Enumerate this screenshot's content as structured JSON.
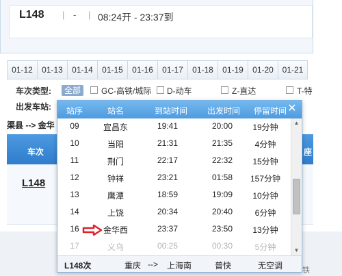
{
  "top": {
    "train_no": "L148",
    "sep": "|",
    "dash": "-",
    "time": "08:24开 - 23:37到"
  },
  "dates": [
    "01-12",
    "01-13",
    "01-14",
    "01-15",
    "01-16",
    "01-17",
    "01-18",
    "01-19",
    "01-20",
    "01-21"
  ],
  "filters": {
    "type_label": "车次类型:",
    "all_label": "全部",
    "gc_label": "GC-高铁/城际",
    "d_label": "D-动车",
    "z_label": "Z-直达",
    "t_label": "T-特",
    "depart_label": "出发车站:"
  },
  "route": "渠县 --> 金华",
  "background_table": {
    "col_train": "车次",
    "col_seat": "座",
    "train": "L148"
  },
  "corner_text": "铁",
  "popup": {
    "headers": {
      "no": "站序",
      "name": "站名",
      "arrive": "到站时间",
      "depart": "出发时间",
      "stay": "停留时间"
    },
    "close_symbol": "✕",
    "rows": [
      {
        "no": "09",
        "name": "宜昌东",
        "arrive": "19:41",
        "depart": "20:00",
        "stay": "19分钟"
      },
      {
        "no": "10",
        "name": "当阳",
        "arrive": "21:31",
        "depart": "21:35",
        "stay": "4分钟"
      },
      {
        "no": "11",
        "name": "荆门",
        "arrive": "22:17",
        "depart": "22:32",
        "stay": "15分钟"
      },
      {
        "no": "12",
        "name": "钟祥",
        "arrive": "23:21",
        "depart": "01:58",
        "stay": "157分钟"
      },
      {
        "no": "13",
        "name": "鹰潭",
        "arrive": "18:59",
        "depart": "19:09",
        "stay": "10分钟"
      },
      {
        "no": "14",
        "name": "上饶",
        "arrive": "20:34",
        "depart": "20:40",
        "stay": "6分钟"
      },
      {
        "no": "16",
        "name": "金华西",
        "arrive": "23:37",
        "depart": "23:50",
        "stay": "13分钟"
      },
      {
        "no": "17",
        "name": "义乌",
        "arrive": "00:25",
        "depart": "00:30",
        "stay": "5分钟"
      }
    ],
    "footer": {
      "train": "L148次",
      "from": "重庆",
      "arrow": "-->",
      "to": "上海南",
      "type": "普快",
      "ac": "无空调"
    },
    "arrow_color": "#e0202a"
  }
}
